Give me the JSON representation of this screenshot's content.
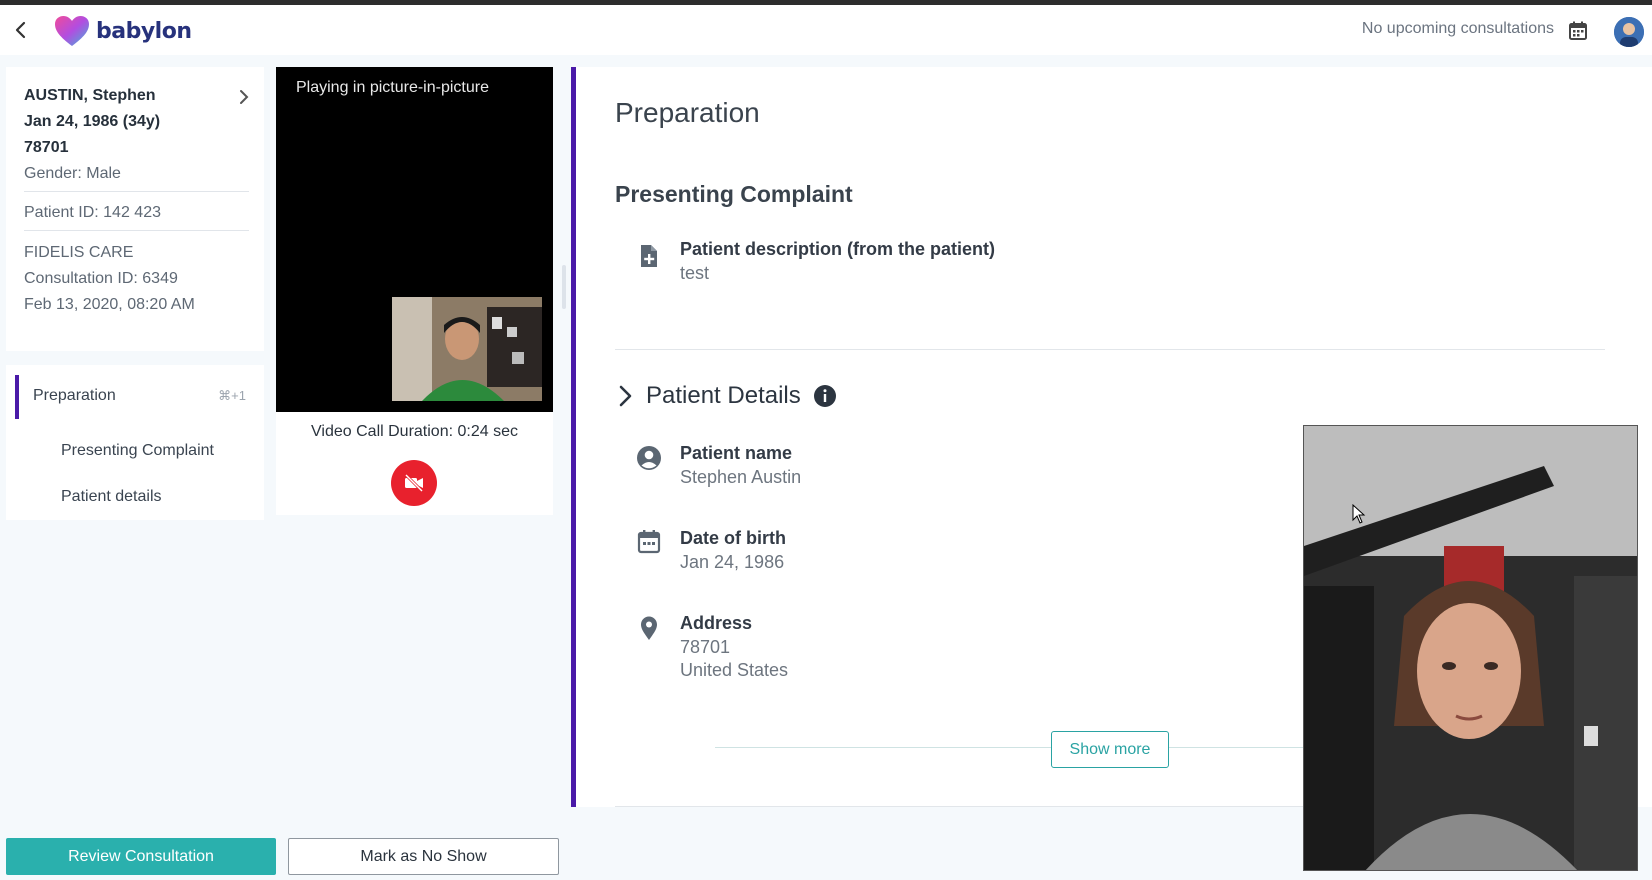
{
  "header": {
    "logo_text": "babylon",
    "upcoming": "No upcoming consultations"
  },
  "patient": {
    "name": "AUSTIN, Stephen",
    "dob_age": "Jan 24, 1986 (34y)",
    "zip": "78701",
    "gender": "Gender: Male",
    "patient_id": "Patient ID: 142 423",
    "insurer": "FIDELIS CARE",
    "consultation_id": "Consultation ID: 6349",
    "consult_datetime": "Feb 13, 2020, 08:20 AM"
  },
  "nav": {
    "items": [
      {
        "label": "Preparation",
        "shortcut": "⌘+1"
      },
      {
        "label": "Presenting Complaint"
      },
      {
        "label": "Patient details"
      }
    ]
  },
  "video": {
    "pip_text": "Playing in picture-in-picture",
    "duration": "Video Call Duration: 0:24 sec"
  },
  "main": {
    "title": "Preparation",
    "presenting_complaint": {
      "heading": "Presenting Complaint",
      "description_label": "Patient description (from the patient)",
      "description_value": "test"
    },
    "patient_details": {
      "heading": "Patient Details",
      "name_label": "Patient name",
      "name_value": "Stephen Austin",
      "dob_label": "Date of birth",
      "dob_value": "Jan 24, 1986",
      "address_label": "Address",
      "address_line1": "78701",
      "address_line2": "United States",
      "show_more": "Show more"
    }
  },
  "footer": {
    "review_label": "Review Consultation",
    "noshow_label": "Mark as No Show"
  },
  "colors": {
    "accent_purple": "#4a1aa8",
    "teal": "#2ab0ad",
    "end_call_red": "#e8212d",
    "logo_navy": "#27327c"
  }
}
